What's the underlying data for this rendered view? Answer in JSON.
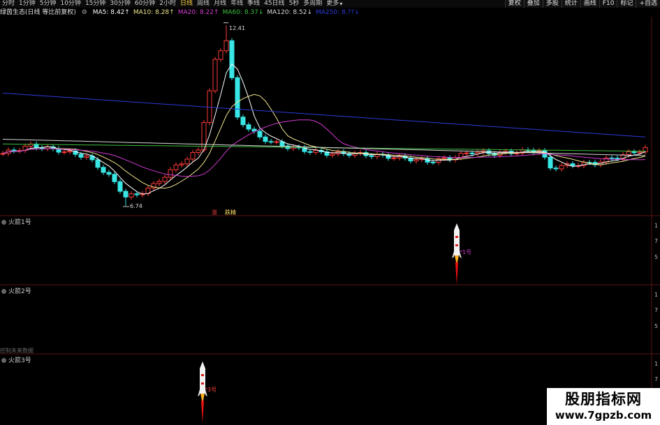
{
  "toolbar": {
    "periods": [
      "分时",
      "1分钟",
      "5分钟",
      "10分钟",
      "15分钟",
      "30分钟",
      "60分钟",
      "2小时",
      "日线",
      "周线",
      "月线",
      "年线",
      "季线",
      "45日线",
      "5秒",
      "多周期",
      "更多"
    ],
    "active_period": "日线",
    "buttons": [
      "复权",
      "叠加",
      "多股",
      "统计",
      "画线",
      "F10",
      "标记",
      "+自选"
    ]
  },
  "legend": {
    "title": "绿茵生态(日线 等比前复权)",
    "items": [
      {
        "label": "MA5: 8.42↑",
        "color": "#ffffff"
      },
      {
        "label": "MA10: 8.28↑",
        "color": "#f0e68c"
      },
      {
        "label": "MA20: 8.22↑",
        "color": "#d23bd2"
      },
      {
        "label": "MA60: 8.37↓",
        "color": "#3fbf3f"
      },
      {
        "label": "MA120: 8.52↓",
        "color": "#d8d8d8"
      },
      {
        "label": "MA250: 8.??↓",
        "color": "#2e3bd8"
      }
    ]
  },
  "price_labels": {
    "high": "12.41",
    "low": "6.74"
  },
  "tags": {
    "zhang": "涨",
    "dietie": "跌精"
  },
  "panes": {
    "p1": {
      "title": "火箭1号",
      "signal": "1号"
    },
    "p2": {
      "title": "火箭2号"
    },
    "p3": {
      "title": "火箭3号",
      "signal": "3号"
    }
  },
  "no_future": "控制未来数据",
  "axis": {
    "p1": [
      "1",
      "7",
      "5"
    ],
    "p2": [
      "1",
      "7",
      "5"
    ],
    "p3": [
      "1",
      "7",
      "5"
    ]
  },
  "watermark": {
    "line1": "股朋指标网",
    "line2": "www.7gpzb.com"
  },
  "colors": {
    "up": "#ff3a3a",
    "down": "#39e6e6",
    "ma5": "#ffffff",
    "ma10": "#f0e68c",
    "ma20": "#d23bd2",
    "ma60": "#3fbf3f",
    "ma120": "#d8d8d8",
    "ma250": "#2e3bd8"
  }
}
